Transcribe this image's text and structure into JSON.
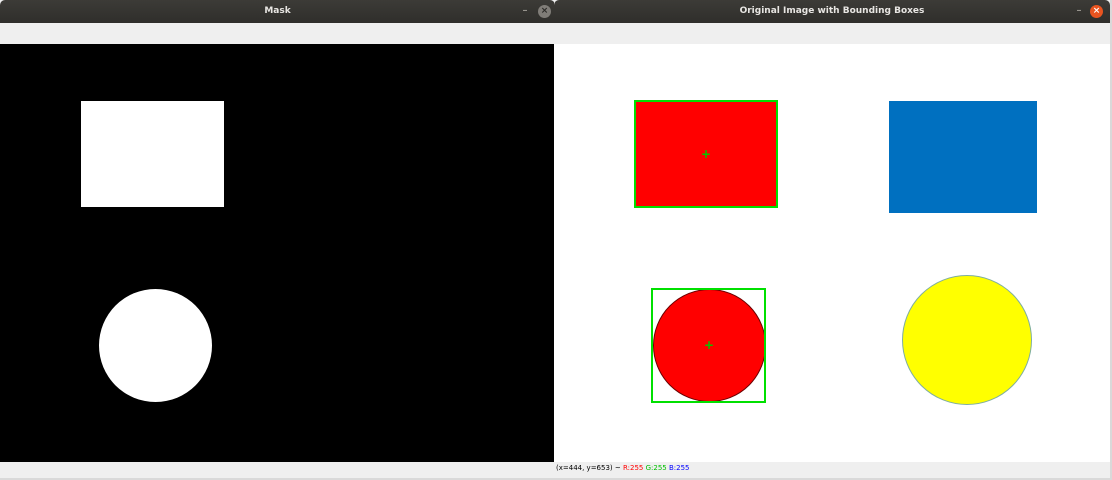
{
  "windows": {
    "mask": {
      "title": "Mask",
      "min_glyph": "–",
      "close_glyph": "×",
      "background": "#000000",
      "shape_color": "#ffffff"
    },
    "original": {
      "title": "Original Image with Bounding Boxes",
      "min_glyph": "–",
      "close_glyph": "×",
      "colors": {
        "red": "#ff0000",
        "blue": "#0070c0",
        "yellow": "#ffff00",
        "bbox": "#00e000"
      },
      "status": {
        "coords": "(x=444, y=653) ~",
        "r": "R:255",
        "g": "G:255",
        "b": "B:255"
      }
    }
  },
  "icons": {
    "minimize": "minimize-icon",
    "close": "close-icon",
    "centroid": "plus-icon"
  },
  "centroid_glyph": "+"
}
